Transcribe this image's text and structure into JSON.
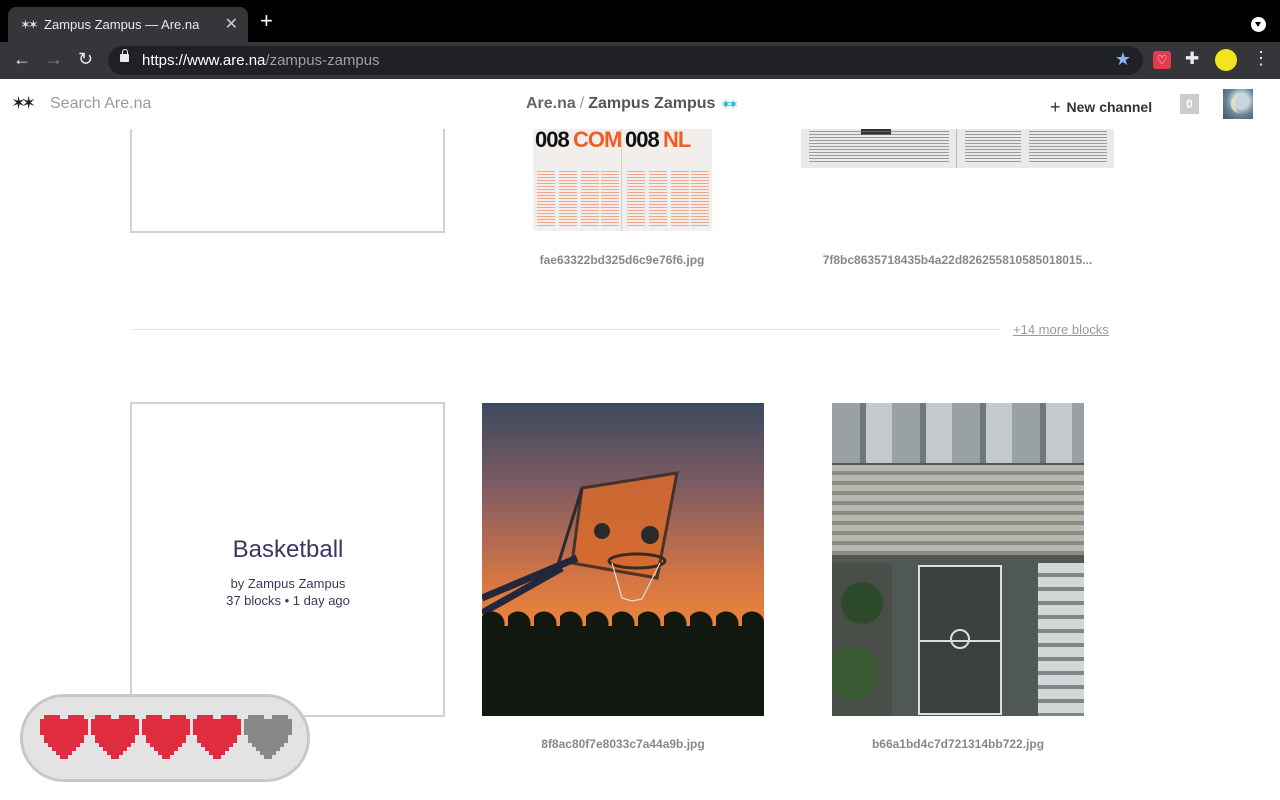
{
  "browser": {
    "tab_title": "Zampus Zampus — Are.na",
    "tab_favicon": "✶✶",
    "close_glyph": "✕",
    "newtab_glyph": "+",
    "url_host": "https://www.are.na",
    "url_path": "/zampus-zampus",
    "back_glyph": "←",
    "forward_glyph": "→",
    "reload_glyph": "↻",
    "star_glyph": "★",
    "ext_heart_glyph": "♡",
    "puzzle_glyph": "✚",
    "kebab_glyph": "⋮"
  },
  "header": {
    "logo": "✶✶",
    "search_placeholder": "Search Are.na",
    "breadcrumb_root": "Are.na",
    "breadcrumb_sep": "/",
    "breadcrumb_current": "Zampus Zampus",
    "breadcrumb_spark": "✶✶",
    "new_channel_plus": "+",
    "new_channel_label": "New channel",
    "notification_count": "0"
  },
  "row1": {
    "img1_caption": "fae63322bd325d6c9e76f6.jpg",
    "img1_headline_a": "008",
    "img1_headline_b": "COM",
    "img1_headline_c": "008",
    "img1_headline_d": "NL",
    "img2_caption": "7f8bc8635718435b4a22d826255810585018015...",
    "more_blocks": "+14 more blocks"
  },
  "row2": {
    "channel_title": "Basketball",
    "channel_by": "by Zampus Zampus",
    "channel_meta": "37 blocks • 1 day ago",
    "img1_caption": "8f8ac80f7e8033c7a44a9b.jpg",
    "img2_caption": "b66a1bd4c7d721314bb722.jpg"
  },
  "hearts_widget": {
    "filled": 4,
    "total": 5,
    "filled_color": "#e02c3f",
    "empty_color": "#888888"
  }
}
